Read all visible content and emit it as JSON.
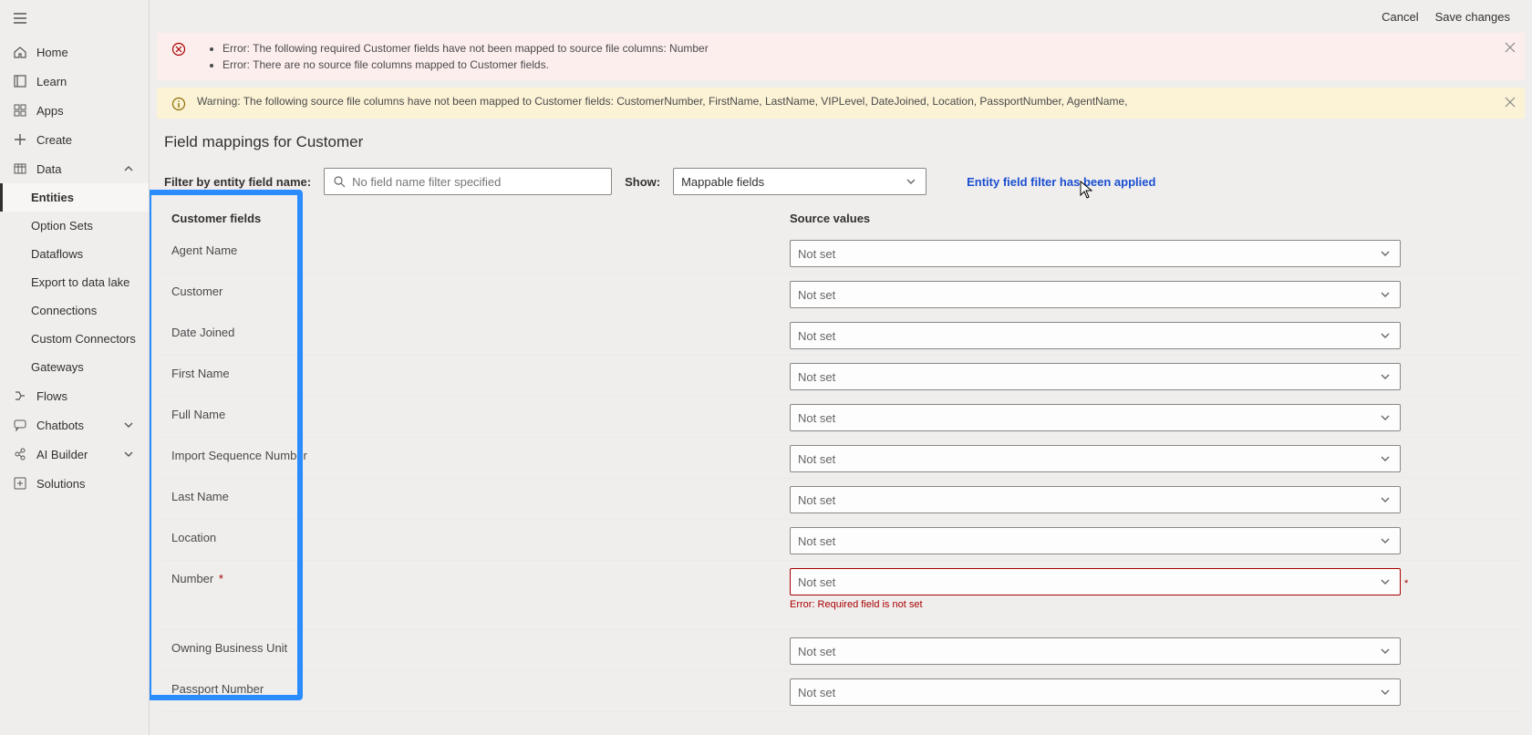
{
  "topbar": {
    "cancel": "Cancel",
    "save": "Save changes"
  },
  "sidebar": {
    "items": [
      {
        "label": "Home"
      },
      {
        "label": "Learn"
      },
      {
        "label": "Apps"
      },
      {
        "label": "Create"
      },
      {
        "label": "Data",
        "children": [
          "Entities",
          "Option Sets",
          "Dataflows",
          "Export to data lake",
          "Connections",
          "Custom Connectors",
          "Gateways"
        ]
      },
      {
        "label": "Flows"
      },
      {
        "label": "Chatbots"
      },
      {
        "label": "AI Builder"
      },
      {
        "label": "Solutions"
      }
    ]
  },
  "banners": {
    "error_items": [
      "Error: The following required Customer fields have not been mapped to source file columns: Number",
      "Error: There are no source file columns mapped to Customer fields."
    ],
    "warning": "Warning: The following source file columns have not been mapped to Customer fields: CustomerNumber, FirstName, LastName, VIPLevel, DateJoined, Location, PassportNumber, AgentName,"
  },
  "page": {
    "title": "Field mappings for Customer",
    "filter_label": "Filter by entity field name:",
    "filter_placeholder": "No field name filter specified",
    "show_label": "Show:",
    "show_value": "Mappable fields",
    "filter_applied": "Entity field filter has been applied"
  },
  "table": {
    "head_field": "Customer fields",
    "head_source": "Source values",
    "not_set": "Not set",
    "required_error": "Error: Required field is not set",
    "rows": [
      {
        "name": "Agent Name",
        "required": false
      },
      {
        "name": "Customer",
        "required": false
      },
      {
        "name": "Date Joined",
        "required": false
      },
      {
        "name": "First Name",
        "required": false
      },
      {
        "name": "Full Name",
        "required": false
      },
      {
        "name": "Import Sequence Number",
        "required": false
      },
      {
        "name": "Last Name",
        "required": false
      },
      {
        "name": "Location",
        "required": false
      },
      {
        "name": "Number",
        "required": true
      },
      {
        "name": "Owning Business Unit",
        "required": false
      },
      {
        "name": "Passport Number",
        "required": false
      }
    ]
  }
}
